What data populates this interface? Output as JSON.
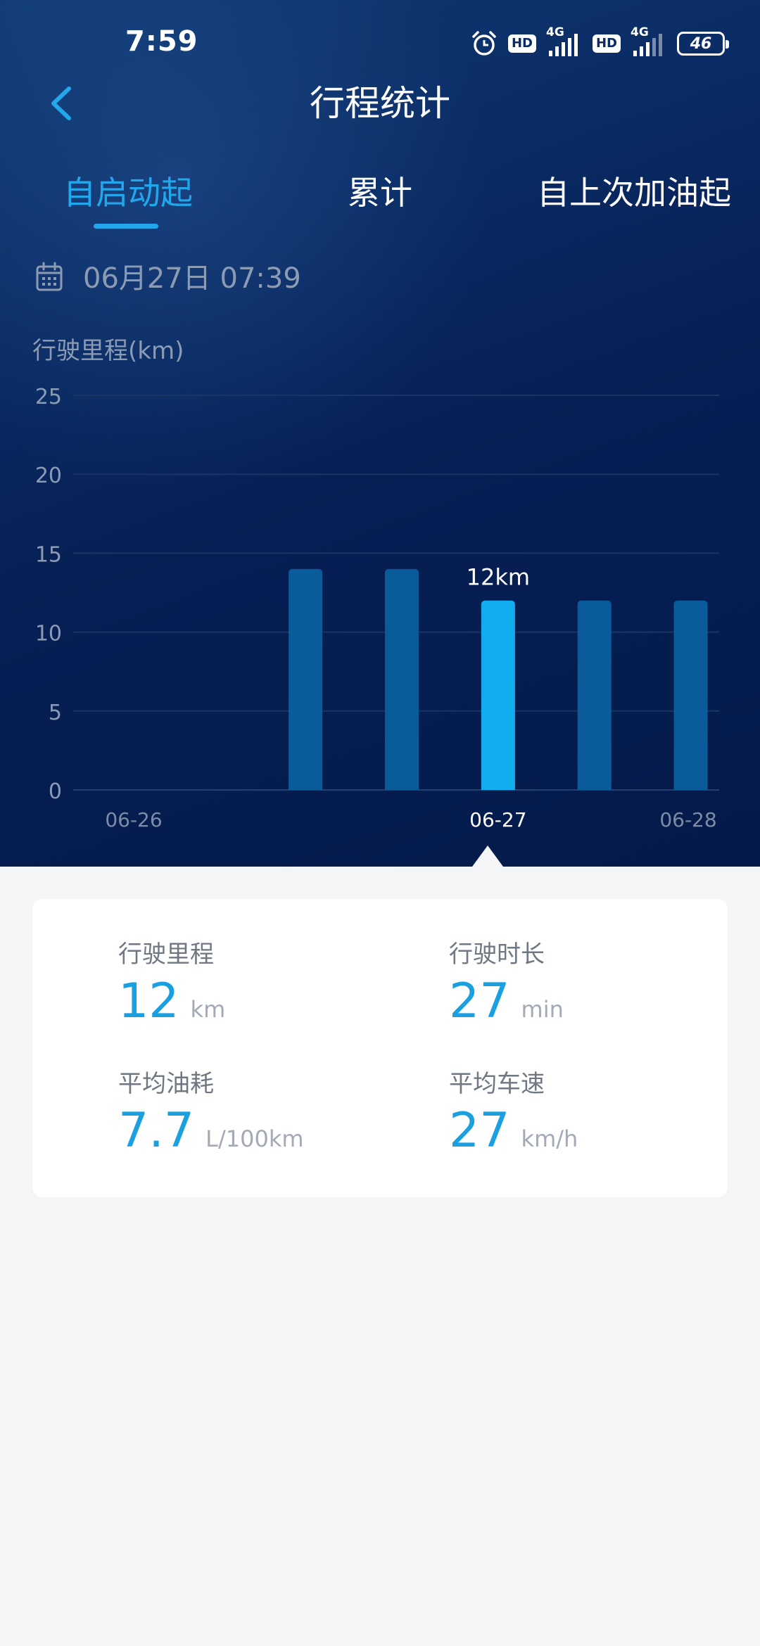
{
  "status_bar": {
    "time": "7:59",
    "hd1": "HD",
    "net1": "4G",
    "hd2": "HD",
    "net2": "4G",
    "battery": "46"
  },
  "header": {
    "title": "行程统计",
    "back_icon": "chevron-left-icon"
  },
  "tabs": [
    {
      "label": "自启动起",
      "active": true
    },
    {
      "label": "累计",
      "active": false
    },
    {
      "label": "自上次加油起",
      "active": false
    }
  ],
  "date": {
    "icon": "calendar-icon",
    "text": "06月27日 07:39"
  },
  "colors": {
    "accent": "#22a7ec",
    "bar": "#0a5b99",
    "bar_selected": "#11adef",
    "value": "#1a9fe0"
  },
  "chart_data": {
    "type": "bar",
    "ylabel": "行驶里程(km)",
    "ylim": [
      0,
      25
    ],
    "yticks": [
      0,
      5,
      10,
      15,
      20,
      25
    ],
    "x_tick_labels": [
      "06-26",
      "06-27",
      "06-28"
    ],
    "values": [
      null,
      null,
      14,
      14,
      12,
      12,
      12
    ],
    "selected_index": 4,
    "selected_label": "12km",
    "grid": true
  },
  "stats": {
    "distance": {
      "label": "行驶里程",
      "value": "12",
      "unit": "km"
    },
    "duration": {
      "label": "行驶时长",
      "value": "27",
      "unit": "min"
    },
    "fuel": {
      "label": "平均油耗",
      "value": "7.7",
      "unit": "L/100km"
    },
    "speed": {
      "label": "平均车速",
      "value": "27",
      "unit": "km/h"
    }
  }
}
